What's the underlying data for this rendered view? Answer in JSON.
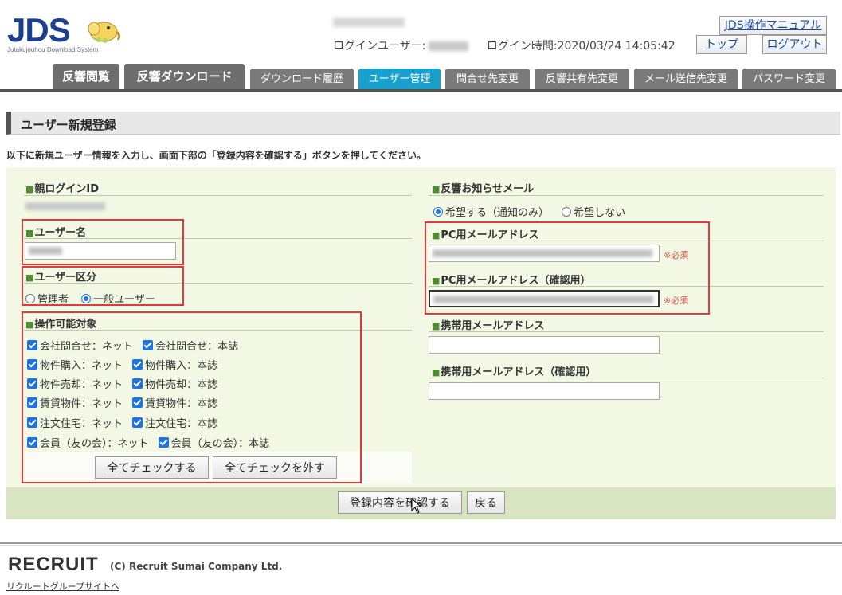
{
  "header": {
    "logo_main": "JDS",
    "logo_sub": "Jutakujouhou Download System",
    "login_user_label": "ログインユーザー:",
    "login_time": "ログイン時間:2020/03/24 14:05:42",
    "manual_label": "JDS操作マニュアル",
    "top_label": "トップ",
    "logout_label": "ログアウト"
  },
  "tabs": [
    {
      "label": "反響閲覧"
    },
    {
      "label": "反響ダウンロード"
    },
    {
      "label": "ダウンロード履歴"
    },
    {
      "label": "ユーザー管理"
    },
    {
      "label": "問合せ先変更"
    },
    {
      "label": "反響共有先変更"
    },
    {
      "label": "メール送信先変更"
    },
    {
      "label": "パスワード変更"
    }
  ],
  "section": {
    "title": "ユーザー新規登録",
    "instruction": "以下に新規ユーザー情報を入力し、画面下部の「登録内容を確認する」ボタンを押してください。"
  },
  "form": {
    "parent_id_label": "親ログインID",
    "user_name_label": "ユーザー名",
    "user_type_label": "ユーザー区分",
    "user_type_options": [
      "管理者",
      "一般ユーザー"
    ],
    "user_type_selected": "一般ユーザー",
    "operation_label": "操作可能対象",
    "checkboxes": [
      [
        "会社問合せ：ネット",
        "会社問合せ：本誌"
      ],
      [
        "物件購入：ネット",
        "物件購入：本誌"
      ],
      [
        "物件売却：ネット",
        "物件売却：本誌"
      ],
      [
        "賃貸物件：ネット",
        "賃貸物件：本誌"
      ],
      [
        "注文住宅：ネット",
        "注文住宅：本誌"
      ],
      [
        "会員（友の会）：ネット",
        "会員（友の会）：本誌"
      ]
    ],
    "check_all_label": "全てチェックする",
    "uncheck_all_label": "全てチェックを外す",
    "notify_mail_label": "反響お知らせメール",
    "notify_options": [
      "希望する（通知のみ）",
      "希望しない"
    ],
    "notify_selected": "希望する（通知のみ）",
    "pc_mail_label": "PC用メールアドレス",
    "pc_mail_confirm_label": "PC用メールアドレス（確認用）",
    "required_mark": "※必須",
    "mobile_mail_label": "携帯用メールアドレス",
    "mobile_mail_confirm_label": "携帯用メールアドレス（確認用）"
  },
  "actions": {
    "confirm_label": "登録内容を確認する",
    "back_label": "戻る"
  },
  "footer": {
    "brand": "RECRUIT",
    "copyright": "(C) Recruit Sumai Company Ltd.",
    "group_link": "リクルートグループサイトへ"
  },
  "colors": {
    "active_tab": "#1aa0cc",
    "tab": "#7a7a7a",
    "panel": "#f2f8e3",
    "highlight": "#e03a3a"
  }
}
